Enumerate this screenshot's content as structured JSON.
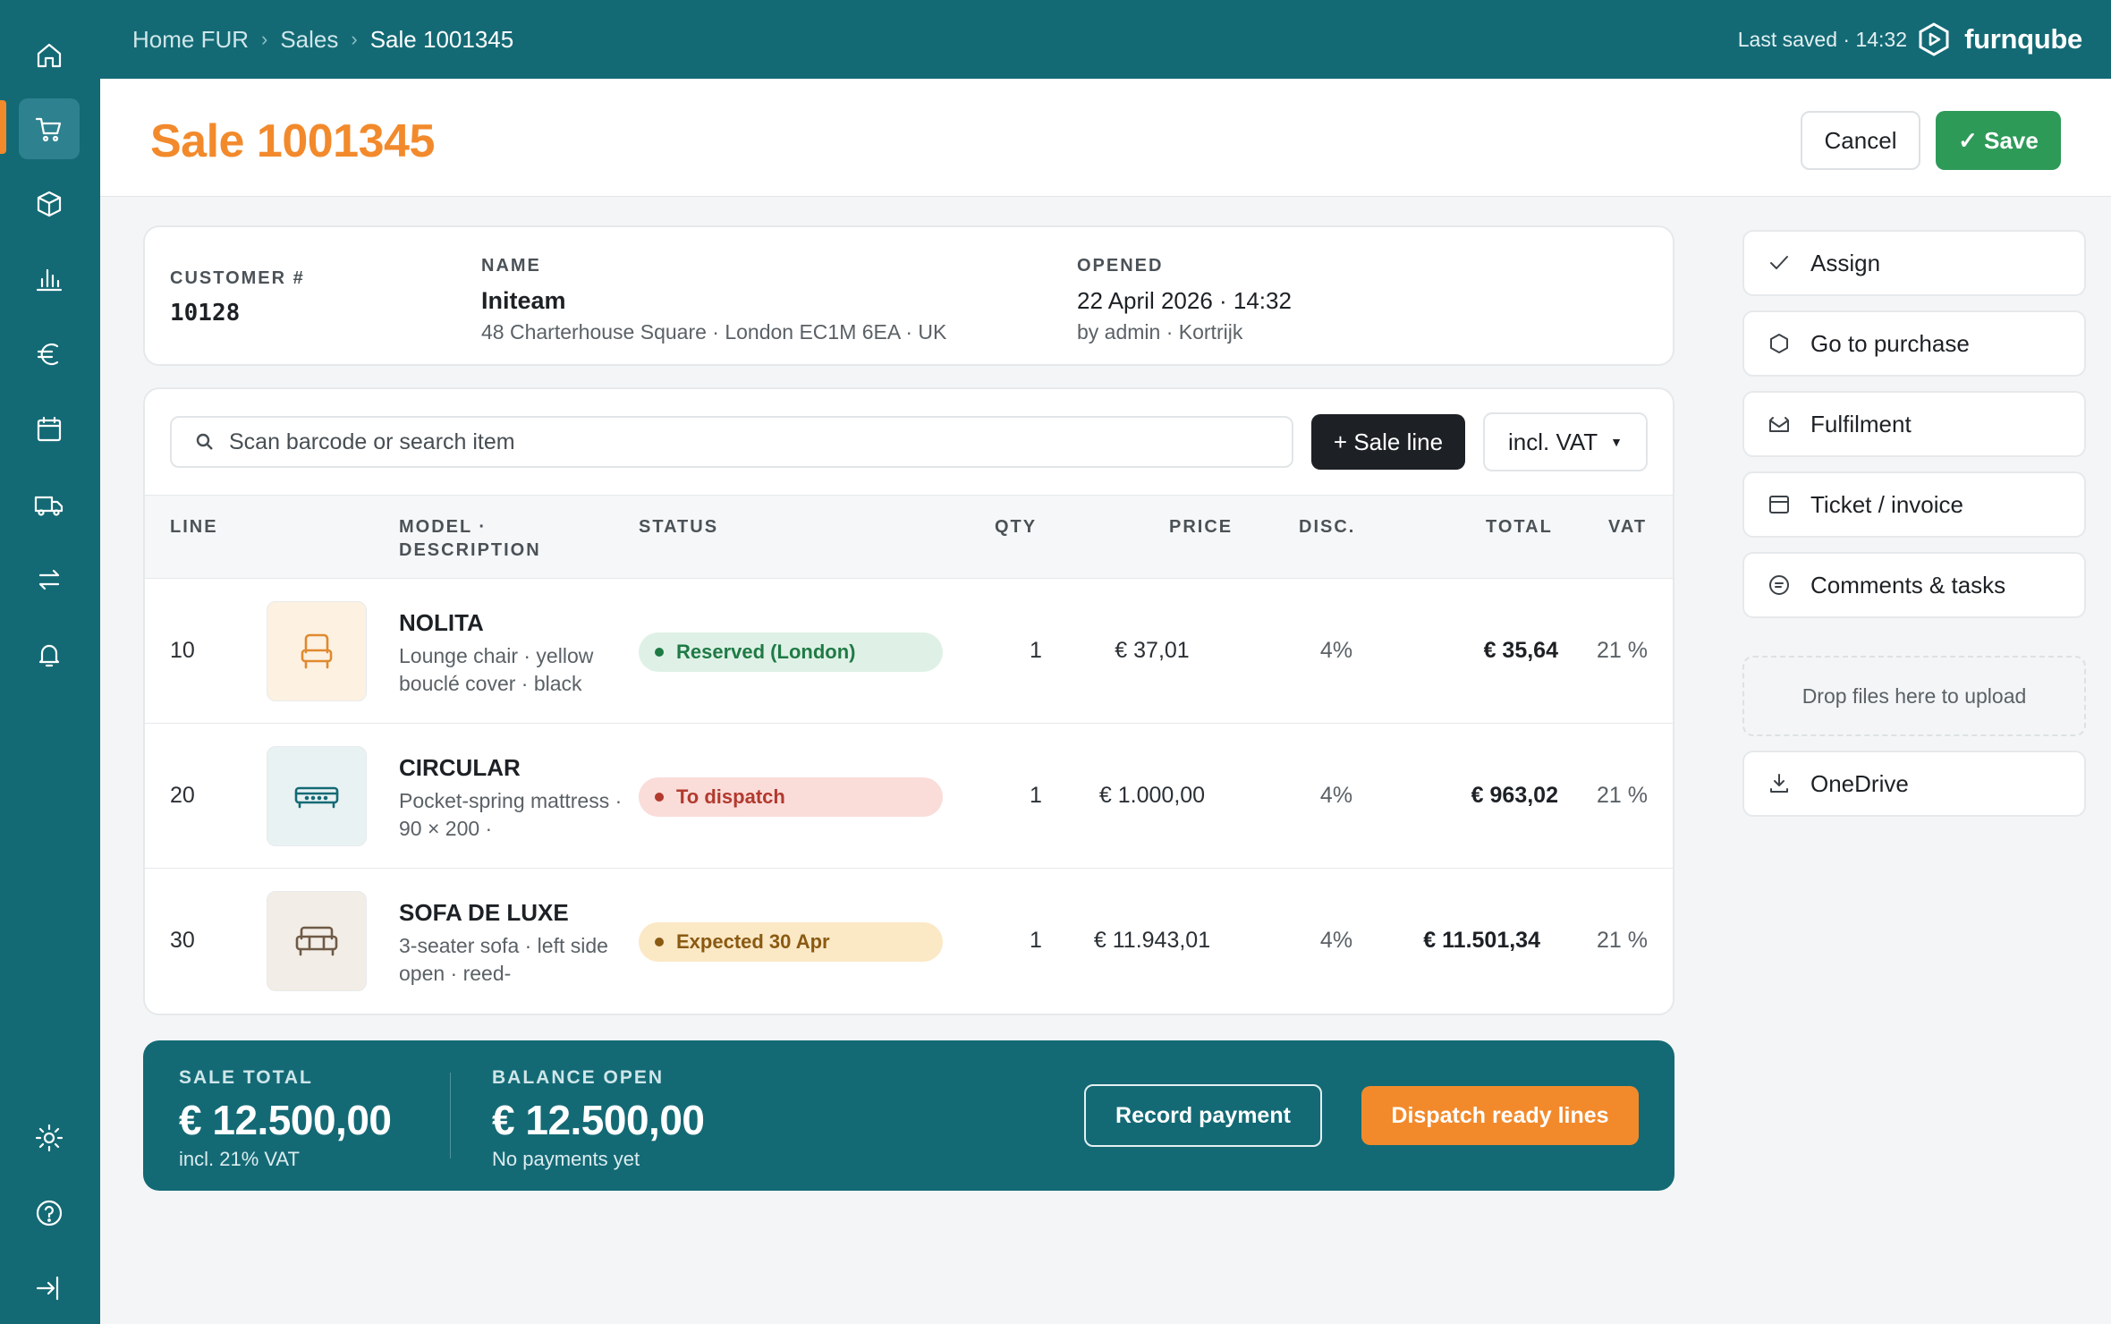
{
  "nav": {
    "items": [
      {
        "name": "home",
        "icon": "home-icon"
      },
      {
        "name": "sales",
        "icon": "cart-icon",
        "active": true
      },
      {
        "name": "products",
        "icon": "box-icon"
      },
      {
        "name": "reports",
        "icon": "bar-chart-icon"
      },
      {
        "name": "finance",
        "icon": "euro-icon"
      },
      {
        "name": "calendar",
        "icon": "calendar-icon"
      },
      {
        "name": "delivery",
        "icon": "truck-icon"
      },
      {
        "name": "transfers",
        "icon": "arrows-icon"
      },
      {
        "name": "notifications",
        "icon": "bell-icon"
      },
      {
        "name": "settings",
        "icon": "sun-gear-icon"
      },
      {
        "name": "help",
        "icon": "help-icon"
      },
      {
        "name": "logout",
        "icon": "logout-icon"
      }
    ]
  },
  "topbar": {
    "breadcrumb": [
      "Home FUR",
      "Sales",
      "Sale 1001345"
    ],
    "last_saved": "Last saved · 14:32",
    "brand": "furnqube"
  },
  "header": {
    "title": "Sale 1001345",
    "cancel_label": "Cancel",
    "save_label": "✓ Save"
  },
  "customer": {
    "number_label": "CUSTOMER #",
    "number": "10128",
    "name_label": "NAME",
    "name": "Initeam",
    "address": "48 Charterhouse Square · London EC1M 6EA · UK",
    "opened_label": "OPENED",
    "opened": "22 April 2026 · 14:32",
    "opened_by": "by admin · Kortrijk"
  },
  "lines": {
    "search_placeholder": "Scan barcode or search item",
    "add_label": "+ Sale line",
    "vat_mode": "incl. VAT",
    "columns": {
      "line": "LINE",
      "model": "MODEL ·",
      "model2": "DESCRIPTION",
      "status": "STATUS",
      "qty": "QTY",
      "price": "PRICE",
      "disc": "DISC.",
      "total": "TOTAL",
      "vat": "VAT"
    },
    "rows": [
      {
        "line": "10",
        "model": "NOLITA",
        "desc": "Lounge chair · yellow bouclé cover · black",
        "status": "Reserved (London)",
        "qty": "1",
        "price": "€ 37,01",
        "disc": "4%",
        "total": "€ 35,64",
        "vat": "21 %"
      },
      {
        "line": "20",
        "model": "CIRCULAR",
        "desc": "Pocket-spring mattress · 90 × 200 ·",
        "status": "To dispatch",
        "qty": "1",
        "price": "€ 1.000,00",
        "disc": "4%",
        "total": "€ 963,02",
        "vat": "21 %"
      },
      {
        "line": "30",
        "model": "SOFA DE LUXE",
        "desc": "3-seater sofa · left side open · reed-",
        "status": "Expected 30 Apr",
        "qty": "1",
        "price": "€ 11.943,01",
        "disc": "4%",
        "total": "€ 11.501,34",
        "vat": "21 %"
      }
    ]
  },
  "totals": {
    "sale_total_label": "SALE TOTAL",
    "sale_total": "€ 12.500,00",
    "sale_total_sub": "incl. 21% VAT",
    "balance_label": "BALANCE OPEN",
    "balance": "€ 12.500,00",
    "balance_sub": "No payments yet",
    "record_label": "Record payment",
    "dispatch_label": "Dispatch ready lines"
  },
  "actions": {
    "assign": "Assign",
    "purchase": "Go to purchase",
    "fulfilment": "Fulfilment",
    "ticket": "Ticket / invoice",
    "comments": "Comments & tasks",
    "dropzone": "Drop files here to upload",
    "onedrive": "OneDrive"
  },
  "colors": {
    "primary": "#136a75",
    "accent": "#f28a2c",
    "success": "#2e9a58",
    "status_reserved_bg": "#dff1e6",
    "status_reserved_fg": "#1f7a45",
    "status_dispatch_bg": "#fadcd9",
    "status_dispatch_fg": "#b23a2e",
    "status_expected_bg": "#fbe8c5",
    "status_expected_fg": "#8a5a12"
  }
}
